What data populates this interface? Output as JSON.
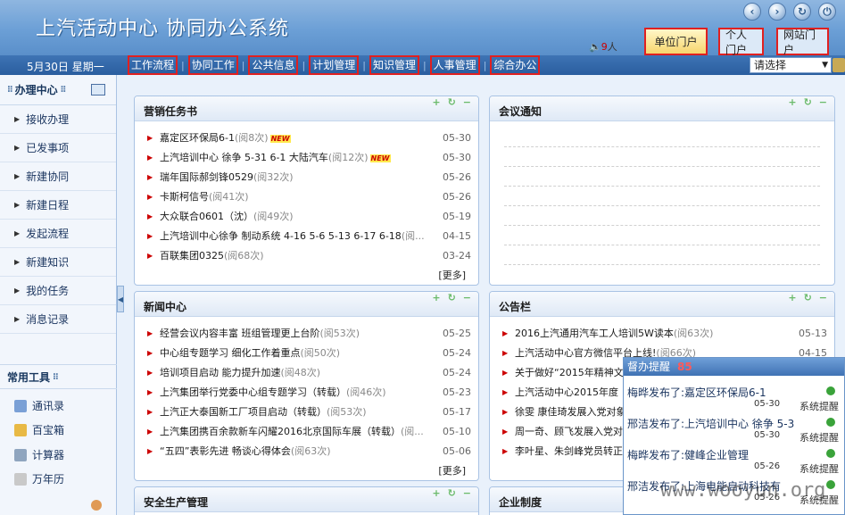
{
  "header": {
    "title": "上汽活动中心  协同办公系统",
    "online_count": "9",
    "online_unit": "人",
    "portal_tabs": [
      "单位门户",
      "个人门户",
      "网站门户"
    ]
  },
  "menubar": {
    "date": "5月30日  星期一",
    "items": [
      "工作流程",
      "协同工作",
      "公共信息",
      "计划管理",
      "知识管理",
      "人事管理",
      "综合办公"
    ],
    "select_value": "请选择"
  },
  "sidebar": {
    "head": "办理中心",
    "items": [
      "接收办理",
      "已发事项",
      "新建协同",
      "新建日程",
      "发起流程",
      "新建知识",
      "我的任务",
      "消息记录"
    ],
    "tools_head": "常用工具",
    "tools": [
      "通讯录",
      "百宝箱",
      "计算器",
      "万年历"
    ]
  },
  "panels": {
    "marketing": {
      "title": "营销任务书",
      "more": "[更多]",
      "rows": [
        {
          "text": "嘉定区环保局6-1",
          "views": "(阅8次)",
          "new": "NEW",
          "date": "05-30"
        },
        {
          "text": "上汽培训中心 徐争 5-31 6-1 大陆汽车",
          "views": "(阅12次)",
          "new": "NEW",
          "date": "05-30"
        },
        {
          "text": "瑞年国际郝剑锋0529",
          "views": "(阅32次)",
          "new": "",
          "date": "05-26"
        },
        {
          "text": "卡斯柯信号",
          "views": "(阅41次)",
          "new": "",
          "date": "05-26"
        },
        {
          "text": "大众联合0601（沈）",
          "views": "(阅49次)",
          "new": "",
          "date": "05-19"
        },
        {
          "text": "上汽培训中心徐争 制动系统 4-16 5-6 5-13 6-17 6-18",
          "views": "(阅...",
          "new": "",
          "date": "04-15"
        },
        {
          "text": "百联集团0325",
          "views": "(阅68次)",
          "new": "",
          "date": "03-24"
        }
      ]
    },
    "meeting": {
      "title": "会议通知"
    },
    "news": {
      "title": "新闻中心",
      "more": "[更多]",
      "rows": [
        {
          "text": "经营会议内容丰富 班组管理更上台阶",
          "views": "(阅53次)",
          "date": "05-25"
        },
        {
          "text": "中心组专题学习 细化工作着重点",
          "views": "(阅50次)",
          "date": "05-24"
        },
        {
          "text": "培训项目启动 能力提升加速",
          "views": "(阅48次)",
          "date": "05-24"
        },
        {
          "text": "上汽集团举行党委中心组专题学习（转载）",
          "views": "(阅46次)",
          "date": "05-23"
        },
        {
          "text": "上汽正大泰国新工厂项目启动（转载）",
          "views": "(阅53次)",
          "date": "05-17"
        },
        {
          "text": "上汽集团携百余款新车闪耀2016北京国际车展（转载）",
          "views": "(阅...",
          "date": "05-10"
        },
        {
          "text": "“五四”表彰先进 畅谈心得体会",
          "views": "(阅63次)",
          "date": "05-06"
        }
      ]
    },
    "notice": {
      "title": "公告栏",
      "rows": [
        {
          "text": "2016上汽通用汽车工人培训5W读本",
          "views": "(阅63次)",
          "date": "05-13"
        },
        {
          "text": "上汽活动中心官方微信平台上线!",
          "views": "(阅66次)",
          "date": "04-15"
        },
        {
          "text": "关于做好“2015年精神文明",
          "views": "",
          "date": ""
        },
        {
          "text": "上汽活动中心2015年度",
          "views": "",
          "date": ""
        },
        {
          "text": "徐雯 康佳琦发展入党对象",
          "views": "",
          "date": ""
        },
        {
          "text": "周一奇、顾飞发展入党对",
          "views": "",
          "date": ""
        },
        {
          "text": "李叶星、朱剑峰党员转正",
          "views": "",
          "date": ""
        }
      ]
    },
    "safety": {
      "title": "安全生产管理"
    },
    "company": {
      "title": "企业制度"
    }
  },
  "popup": {
    "title": "督办提醒",
    "count": "85",
    "items": [
      {
        "text": "梅晔发布了:嘉定区环保局6-1",
        "date": "05-30",
        "mark": "系统提醒"
      },
      {
        "text": "邢洁发布了:上汽培训中心 徐争 5-3",
        "date": "05-30",
        "mark": "系统提醒"
      },
      {
        "text": "梅晔发布了:健峰企业管理",
        "date": "05-26",
        "mark": "系统提醒"
      },
      {
        "text": "邢洁发布了:上海电能启动科技有",
        "date": "05-26",
        "mark": "系统提醒"
      }
    ],
    "watermark": "www.wooyun.org"
  }
}
